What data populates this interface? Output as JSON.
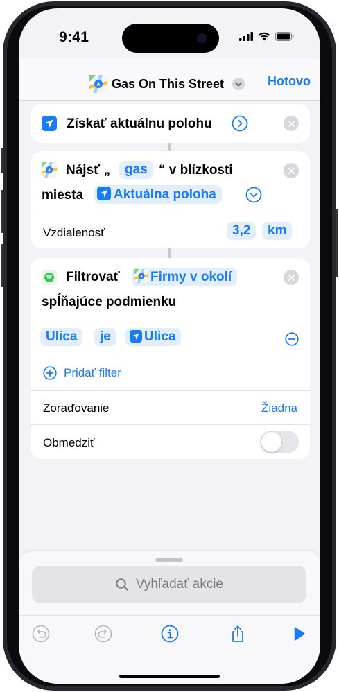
{
  "status": {
    "time": "9:41"
  },
  "nav": {
    "title": "Gas On This Street",
    "done": "Hotovo"
  },
  "action1": {
    "title": "Získať aktuálnu polohu"
  },
  "action2": {
    "part1": "Nájsť „",
    "query": "gas",
    "part2": "“ v blízkosti",
    "part3": "miesta",
    "location": "Aktuálna poloha",
    "distance_label": "Vzdialenosť",
    "distance_value": "3,2",
    "distance_unit": "km"
  },
  "action3": {
    "part1": "Filtrovať",
    "source": "Firmy v okolí",
    "part2": "spĺňajúce podmienku",
    "filter_field": "Ulica",
    "filter_op": "je",
    "filter_value": "Ulica",
    "add_filter": "Pridať filter",
    "sort_label": "Zoraďovanie",
    "sort_value": "Žiadna",
    "limit_label": "Obmedziť",
    "limit_enabled": false
  },
  "sheet": {
    "search_placeholder": "Vyhľadať akcie"
  },
  "colors": {
    "accent": "#1a7cf5",
    "background": "#f2f2f7"
  }
}
